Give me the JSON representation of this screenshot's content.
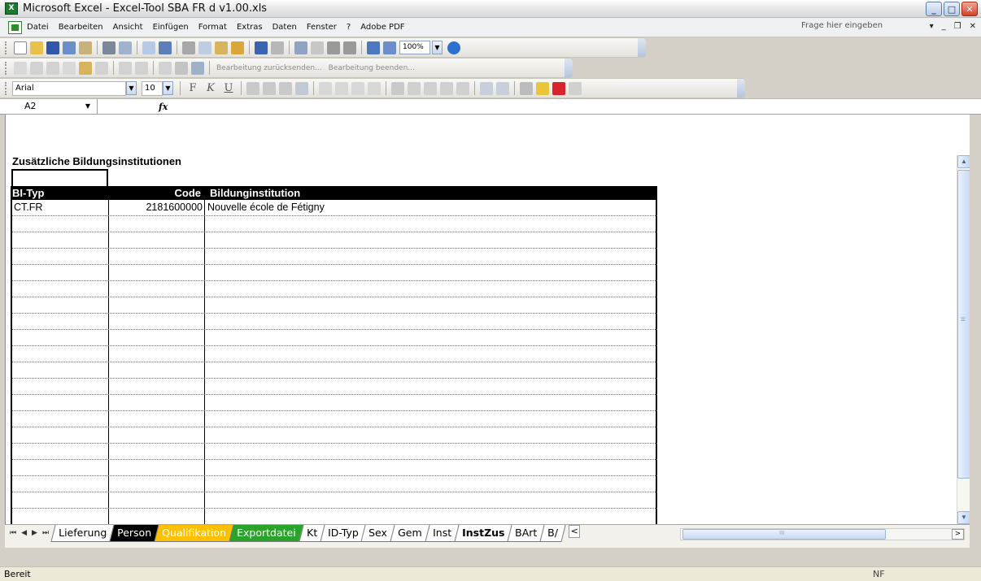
{
  "window": {
    "title": "Microsoft Excel - Excel-Tool SBA FR d v1.00.xls"
  },
  "menu": {
    "items": [
      "Datei",
      "Bearbeiten",
      "Ansicht",
      "Einfügen",
      "Format",
      "Extras",
      "Daten",
      "Fenster",
      "?",
      "Adobe PDF"
    ],
    "help_placeholder": "Frage hier eingeben"
  },
  "toolbar": {
    "zoom": "100%",
    "review_reply": "Bearbeitung zurücksenden...",
    "review_end": "Bearbeitung beenden...",
    "font_name": "Arial",
    "font_size": "10",
    "bold": "F",
    "italic": "K",
    "underline": "U"
  },
  "formula_bar": {
    "name_box": "A2",
    "fx": "fx",
    "content": ""
  },
  "sheet": {
    "title": "Zusätzliche Bildungsinstitutionen",
    "headers": [
      "BI-Typ",
      "Code",
      "Bildunginstitution"
    ],
    "rows": [
      [
        "CT.FR",
        "2181600000",
        "Nouvelle école de Fétigny"
      ]
    ]
  },
  "tabs": [
    "Lieferung",
    "Person",
    "Qualifikation",
    "Exportdatei",
    "Kt",
    "ID-Typ",
    "Sex",
    "Gem",
    "Inst",
    "InstZus",
    "BArt",
    "B/"
  ],
  "active_tab": "InstZus",
  "colors": {
    "person_tab": "#000000",
    "qualifikation_tab": "#ffc000",
    "exportdatei_tab": "#29a329"
  },
  "status": {
    "left": "Bereit",
    "right": "NF"
  }
}
